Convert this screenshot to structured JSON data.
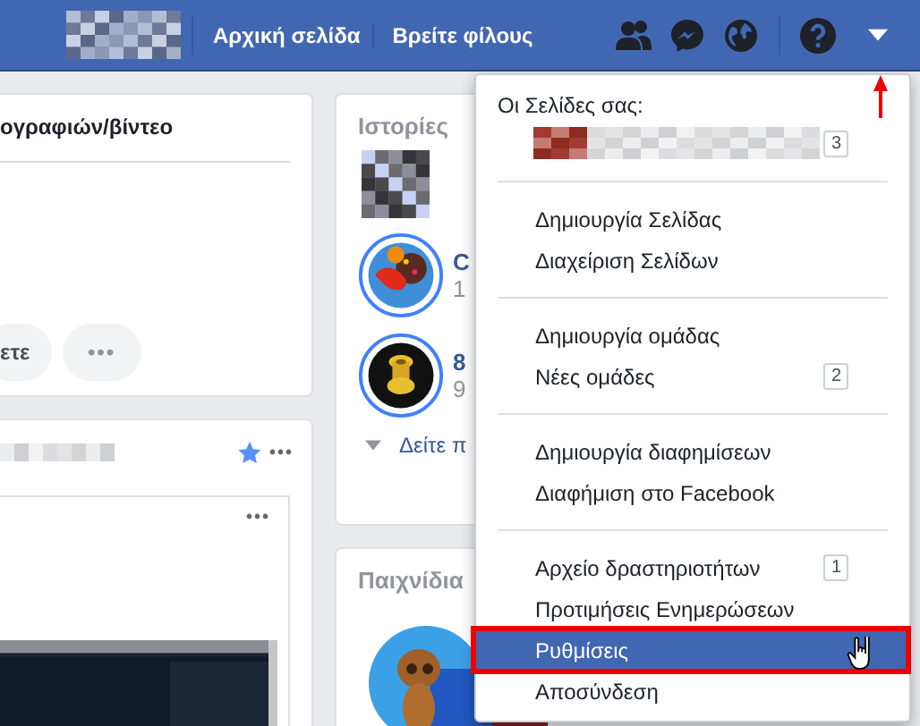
{
  "top_bar": {
    "nav_links": [
      {
        "label": "Αρχική σελίδα"
      },
      {
        "label": "Βρείτε φίλους"
      }
    ]
  },
  "composer": {
    "title": "ογραφιών/βίντεο",
    "buttons": [
      {
        "label": "ετε"
      },
      {
        "label": "•••"
      }
    ]
  },
  "post": {
    "menu": "•••",
    "inner_menu": "•••"
  },
  "stories": {
    "title": "Ιστορίες",
    "items": [
      {
        "kind": "candy",
        "name": "C",
        "count": "1"
      },
      {
        "kind": "ball",
        "name": "8",
        "count": "9"
      }
    ],
    "see_more": "Δείτε π"
  },
  "games": {
    "title": "Παιχνίδια"
  },
  "menu": {
    "header": "Οι Σελίδες σας:",
    "page_badge": "3",
    "groups": [
      {
        "items": [
          {
            "label": "Δημιουργία Σελίδας",
            "selected": false
          },
          {
            "label": "Διαχείριση Σελίδων",
            "selected": false
          }
        ]
      },
      {
        "items": [
          {
            "label": "Δημιουργία ομάδας",
            "selected": false
          },
          {
            "label": "Νέες ομάδες",
            "badge": "2",
            "selected": false
          }
        ]
      },
      {
        "items": [
          {
            "label": "Δημιουργία διαφημίσεων",
            "selected": false
          },
          {
            "label": "Διαφήμιση στο Facebook",
            "selected": false
          }
        ]
      },
      {
        "items": [
          {
            "label": "Αρχείο δραστηριοτήτων",
            "badge": "1",
            "selected": false
          },
          {
            "label": "Προτιμήσεις Ενημερώσεων",
            "selected": false
          },
          {
            "label": "Ρυθμίσεις",
            "selected": true
          },
          {
            "label": "Αποσύνδεση",
            "selected": false
          }
        ]
      }
    ]
  }
}
